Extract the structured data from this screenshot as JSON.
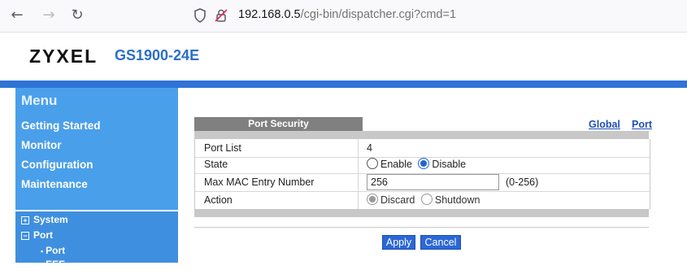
{
  "browser": {
    "url_host": "192.168.0.5",
    "url_path": "/cgi-bin/dispatcher.cgi?cmd=1"
  },
  "header": {
    "logo": "ZYXEL",
    "model": "GS1900-24E"
  },
  "sidebar": {
    "title": "Menu",
    "links": [
      "Getting Started",
      "Monitor",
      "Configuration",
      "Maintenance"
    ],
    "tree": {
      "system": "System",
      "port": "Port",
      "port_child": "Port",
      "cut_item": "EEE"
    },
    "tree_box_plus": "+",
    "tree_box_minus": "−",
    "bullet": "•"
  },
  "main": {
    "tab_title": "Port Security",
    "links": {
      "global": "Global",
      "port": "Port"
    },
    "rows": {
      "port_list_label": "Port List",
      "port_list_value": "4",
      "state_label": "State",
      "state_enable": "Enable",
      "state_disable": "Disable",
      "state_selected": "Disable",
      "max_mac_label": "Max MAC Entry Number",
      "max_mac_value": "256",
      "max_mac_range": "(0-256)",
      "action_label": "Action",
      "action_discard": "Discard",
      "action_shutdown": "Shutdown",
      "action_selected": "Discard"
    },
    "buttons": {
      "apply": "Apply",
      "cancel": "Cancel"
    }
  },
  "colors": {
    "brand_blue": "#2f73d6",
    "menu_bg": "#4a9fea",
    "link": "#1f4fb8"
  }
}
